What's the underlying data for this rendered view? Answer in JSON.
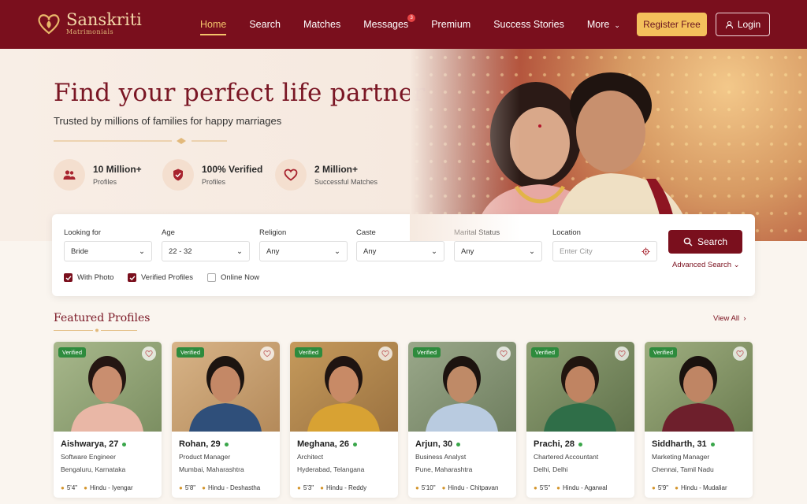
{
  "brand": {
    "name": "Sanskriti",
    "tagline": "Matrimonials"
  },
  "nav": {
    "items": [
      {
        "label": "Home",
        "active": true
      },
      {
        "label": "Search"
      },
      {
        "label": "Matches"
      },
      {
        "label": "Messages",
        "badge": "3"
      },
      {
        "label": "Premium"
      },
      {
        "label": "Success Stories"
      },
      {
        "label": "More",
        "dropdown": true
      }
    ],
    "register_label": "Register Free",
    "login_label": "Login"
  },
  "hero": {
    "title": "Find your perfect life partner",
    "subtitle": "Trusted by millions of families for happy marriages",
    "stats": [
      {
        "value": "10 Million+",
        "label": "Profiles",
        "icon": "users-icon"
      },
      {
        "value": "100% Verified",
        "label": "Profiles",
        "icon": "shield-check-icon"
      },
      {
        "value": "2 Million+",
        "label": "Successful Matches",
        "icon": "heart-icon"
      }
    ]
  },
  "search": {
    "fields": [
      {
        "label": "Looking for",
        "value": "Bride"
      },
      {
        "label": "Age",
        "value": "22 - 32"
      },
      {
        "label": "Religion",
        "value": "Any"
      },
      {
        "label": "Caste",
        "value": "Any"
      },
      {
        "label": "Marital Status",
        "value": "Any"
      },
      {
        "label": "Location",
        "placeholder": "Enter City"
      }
    ],
    "checkboxes": [
      {
        "label": "With Photo",
        "checked": true
      },
      {
        "label": "Verified Profiles",
        "checked": true
      },
      {
        "label": "Online Now",
        "checked": false
      }
    ],
    "button_label": "Search",
    "advanced_label": "Advanced Search"
  },
  "featured": {
    "title": "Featured Profiles",
    "view_all": "View All",
    "verified_label": "Verified",
    "profiles": [
      {
        "name": "Aishwarya, 27",
        "job": "Software Engineer",
        "location": "Bengaluru, Karnataka",
        "height": "5'4\"",
        "community": "Hindu - Iyengar"
      },
      {
        "name": "Rohan, 29",
        "job": "Product Manager",
        "location": "Mumbai, Maharashtra",
        "height": "5'8\"",
        "community": "Hindu - Deshastha"
      },
      {
        "name": "Meghana, 26",
        "job": "Architect",
        "location": "Hyderabad, Telangana",
        "height": "5'3\"",
        "community": "Hindu - Reddy"
      },
      {
        "name": "Arjun, 30",
        "job": "Business Analyst",
        "location": "Pune, Maharashtra",
        "height": "5'10\"",
        "community": "Hindu - Chitpavan"
      },
      {
        "name": "Prachi, 28",
        "job": "Chartered Accountant",
        "location": "Delhi, Delhi",
        "height": "5'5\"",
        "community": "Hindu - Agarwal"
      },
      {
        "name": "Siddharth, 31",
        "job": "Marketing Manager",
        "location": "Chennai, Tamil Nadu",
        "height": "5'9\"",
        "community": "Hindu - Mudaliar"
      }
    ]
  },
  "colors": {
    "brand": "#7a0f1d",
    "accent": "#f4c05c",
    "verified": "#2e8b3d",
    "online": "#3aa64a"
  }
}
